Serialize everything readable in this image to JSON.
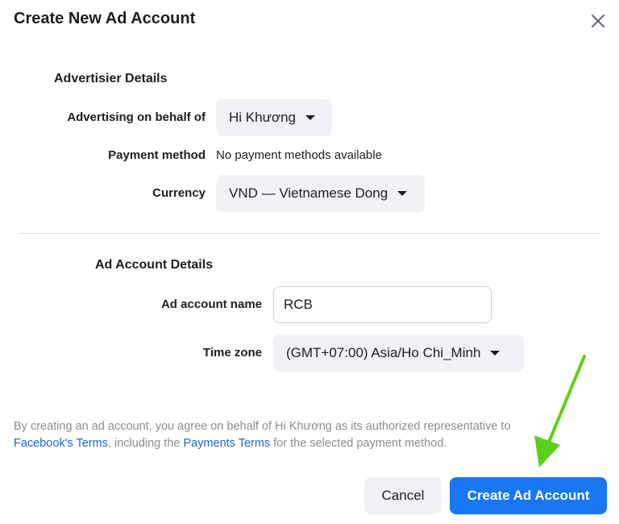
{
  "dialog": {
    "title": "Create New Ad Account",
    "close_icon": "close-icon"
  },
  "advertiser_section": {
    "title": "Advertisier Details",
    "advertising_on_behalf_of": {
      "label": "Advertising on behalf of",
      "value": "Hi Khương"
    },
    "payment_method": {
      "label": "Payment method",
      "value": "No payment methods available"
    },
    "currency": {
      "label": "Currency",
      "value": "VND — Vietnamese Dong"
    }
  },
  "ad_account_section": {
    "title": "Ad Account Details",
    "ad_account_name": {
      "label": "Ad account name",
      "value": "RCB"
    },
    "time_zone": {
      "label": "Time zone",
      "value": "(GMT+07:00) Asia/Ho Chi_Minh"
    }
  },
  "terms": {
    "text_1": "By creating an ad account, you agree on behalf of Hi Khương as its authorized representative to ",
    "link_1": "Facebook's Terms",
    "text_2": ", including the ",
    "link_2": "Payments Terms",
    "text_3": " for the selected payment method."
  },
  "footer": {
    "cancel_label": "Cancel",
    "create_label": "Create Ad Account"
  },
  "annotation": {
    "arrow_color": "#5ccf1a",
    "arrow_icon": "arrow-down-icon"
  },
  "colors": {
    "primary": "#1877f2",
    "link": "#1b64c9",
    "select_bg": "#f0f2f5"
  }
}
